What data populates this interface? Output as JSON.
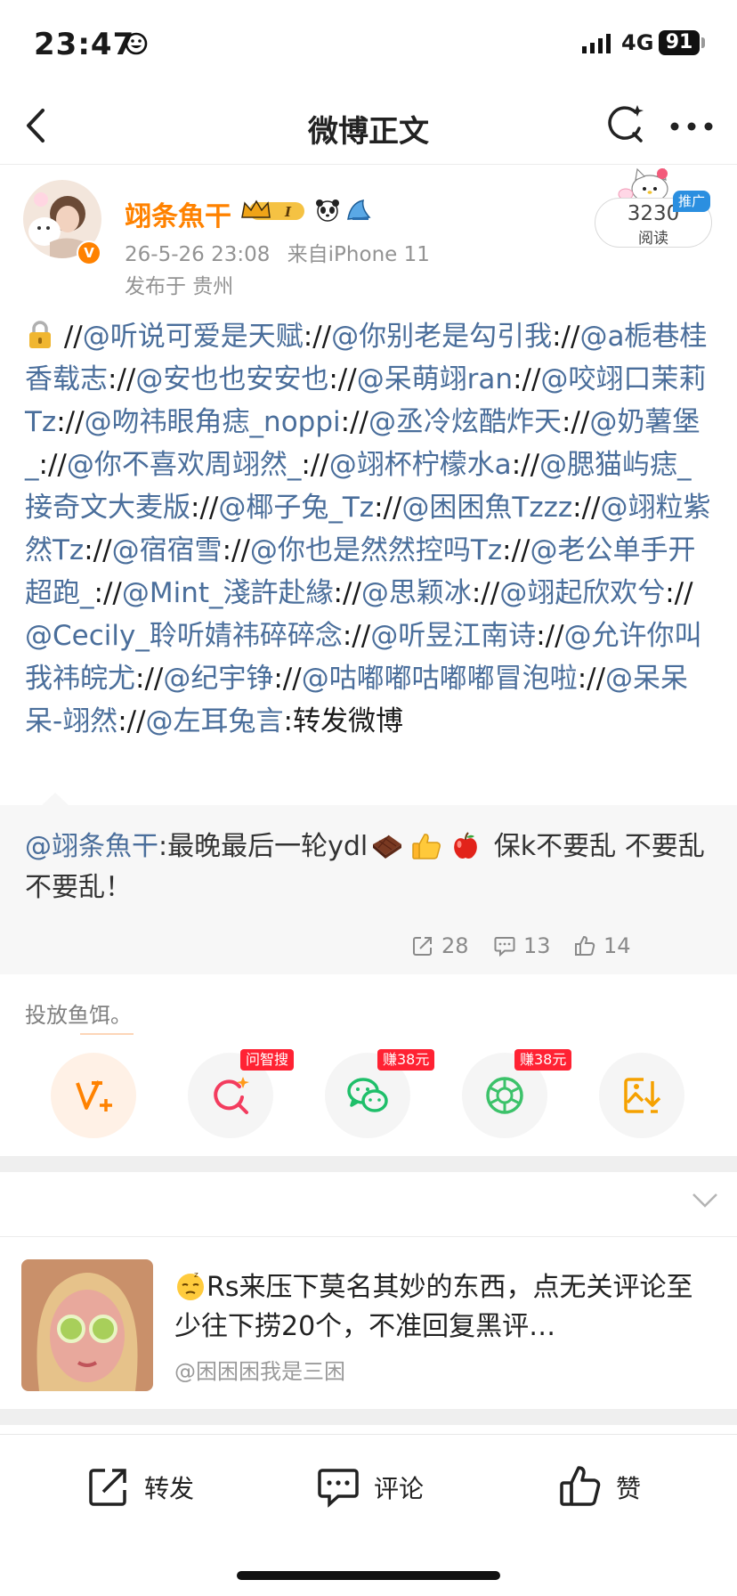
{
  "status_bar": {
    "time": "23:47",
    "network": "4G",
    "battery": "91"
  },
  "nav": {
    "title": "微博正文"
  },
  "post": {
    "username": "翊条魚干",
    "level_badge": "I",
    "vip_badge": "V",
    "timestamp": "26-5-26 23:08",
    "source": "来自iPhone 11",
    "location": "发布于 贵州",
    "read_count": "3230",
    "read_label": "阅读",
    "promo_tag": "推广",
    "segments": [
      {
        "t": "//",
        "m": false
      },
      {
        "t": "@听说可爱是天赋",
        "m": true
      },
      {
        "t": "://",
        "m": false
      },
      {
        "t": "@你别老是勾引我",
        "m": true
      },
      {
        "t": "://",
        "m": false
      },
      {
        "t": "@a栀巷桂香载志",
        "m": true
      },
      {
        "t": "://",
        "m": false
      },
      {
        "t": "@安也也安安也",
        "m": true
      },
      {
        "t": "://",
        "m": false
      },
      {
        "t": "@呆萌翊ran",
        "m": true
      },
      {
        "t": "://",
        "m": false
      },
      {
        "t": "@咬翊口茉莉Tz",
        "m": true
      },
      {
        "t": "://",
        "m": false
      },
      {
        "t": "@吻祎眼角痣_noppi",
        "m": true
      },
      {
        "t": "://",
        "m": false
      },
      {
        "t": "@丞冷炫酷炸天",
        "m": true
      },
      {
        "t": "://",
        "m": false
      },
      {
        "t": "@奶薯堡_",
        "m": true
      },
      {
        "t": "://",
        "m": false
      },
      {
        "t": "@你不喜欢周翊然_",
        "m": true
      },
      {
        "t": "://",
        "m": false
      },
      {
        "t": "@翊杯柠檬水a",
        "m": true
      },
      {
        "t": "://",
        "m": false
      },
      {
        "t": "@腮猫屿痣_接奇文大麦版",
        "m": true
      },
      {
        "t": "://",
        "m": false
      },
      {
        "t": "@椰子兔_Tz",
        "m": true
      },
      {
        "t": "://",
        "m": false
      },
      {
        "t": "@困困魚Tzzz",
        "m": true
      },
      {
        "t": "://",
        "m": false
      },
      {
        "t": "@翊粒紫然Tz",
        "m": true
      },
      {
        "t": "://",
        "m": false
      },
      {
        "t": "@宿宿雪",
        "m": true
      },
      {
        "t": "://",
        "m": false
      },
      {
        "t": "@你也是然然控吗Tz",
        "m": true
      },
      {
        "t": "://",
        "m": false
      },
      {
        "t": "@老公单手开超跑_",
        "m": true
      },
      {
        "t": "://",
        "m": false
      },
      {
        "t": "@Mint_淺許赴緣",
        "m": true
      },
      {
        "t": "://",
        "m": false
      },
      {
        "t": "@思颖冰",
        "m": true
      },
      {
        "t": "://",
        "m": false
      },
      {
        "t": "@翊起欣欢兮",
        "m": true
      },
      {
        "t": "://",
        "m": false
      },
      {
        "t": "@Cecily_聆听婧祎碎碎念",
        "m": true
      },
      {
        "t": "://",
        "m": false
      },
      {
        "t": "@听昱江南诗",
        "m": true
      },
      {
        "t": "://",
        "m": false
      },
      {
        "t": "@允许你叫我祎皖尤",
        "m": true
      },
      {
        "t": "://",
        "m": false
      },
      {
        "t": "@纪宇铮",
        "m": true
      },
      {
        "t": "://",
        "m": false
      },
      {
        "t": "@咕嘟嘟咕嘟嘟冒泡啦",
        "m": true
      },
      {
        "t": "://",
        "m": false
      },
      {
        "t": "@呆呆呆-翊然",
        "m": true
      },
      {
        "t": "://",
        "m": false
      },
      {
        "t": "@左耳兔言",
        "m": true
      },
      {
        "t": ":转发微博",
        "m": false
      }
    ]
  },
  "quote": {
    "mention": "@翊条魚干",
    "text_before": ":最晚最后一轮ydl",
    "text_after": " 保k不要乱 不要乱 不要乱！",
    "emoji_icons": [
      "chocolate-icon",
      "thumbs-up-icon",
      "apple-icon"
    ],
    "reposts": "28",
    "comments": "13",
    "likes": "14"
  },
  "bait": {
    "label": "投放鱼饵。",
    "buttons": [
      {
        "icon": "v-plus-icon",
        "tag": ""
      },
      {
        "icon": "ai-search-icon",
        "tag": "问智搜"
      },
      {
        "icon": "wechat-icon",
        "tag": "赚38元"
      },
      {
        "icon": "moments-icon",
        "tag": "赚38元"
      },
      {
        "icon": "save-image-icon",
        "tag": ""
      }
    ]
  },
  "recommend": {
    "title": "Rs来压下莫名其妙的东西，点无关评论至少往下捞20个，不准回复黑评…",
    "author": "@困困困我是三困"
  },
  "toolbar": {
    "repost": "转发",
    "comment": "评论",
    "like": "赞"
  },
  "colors": {
    "brand_orange": "#ff8200",
    "mention_blue": "#4a6e9b",
    "promo_blue": "#2b8fe0",
    "tag_red": "#ff2233"
  }
}
